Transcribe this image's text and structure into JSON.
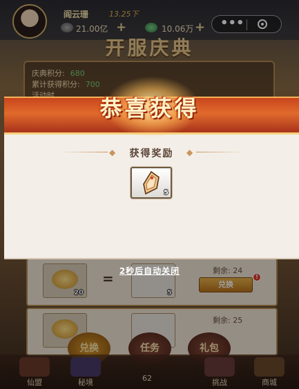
{
  "player": {
    "name": "阎云珊",
    "vip_text": "13.25下",
    "gold": "21.00亿",
    "jade": "10.06万"
  },
  "capsule": {
    "more_glyph": "•••"
  },
  "event": {
    "title": "开服庆典",
    "score_label": "庆典积分:",
    "score_value": "680",
    "total_label": "累计获得积分:",
    "total_value": "700",
    "activity_label": "活动时"
  },
  "popup": {
    "title": "恭喜获得",
    "reward_header": "获得奖励",
    "reward_item": {
      "icon": "scroll-token-icon",
      "count": "5"
    },
    "close_hint": "2秒后自动关闭"
  },
  "exchange_rows": [
    {
      "cost_count": "20",
      "item_count": "5",
      "remain_label": "剩余: 24",
      "button_label": "兑换",
      "badge": "!"
    },
    {
      "remain_label": "剩余: 25"
    }
  ],
  "tabs": {
    "exchange": "兑换",
    "tasks": "任务",
    "gift": "礼包"
  },
  "bottom_nav": {
    "items": [
      "仙盟",
      "秘境",
      "挑战",
      "商城"
    ],
    "page_number": "62"
  },
  "colors": {
    "banner_red": "#c9461d",
    "popup_bg": "#f3eee8",
    "accent_gold": "#e9b24a"
  }
}
